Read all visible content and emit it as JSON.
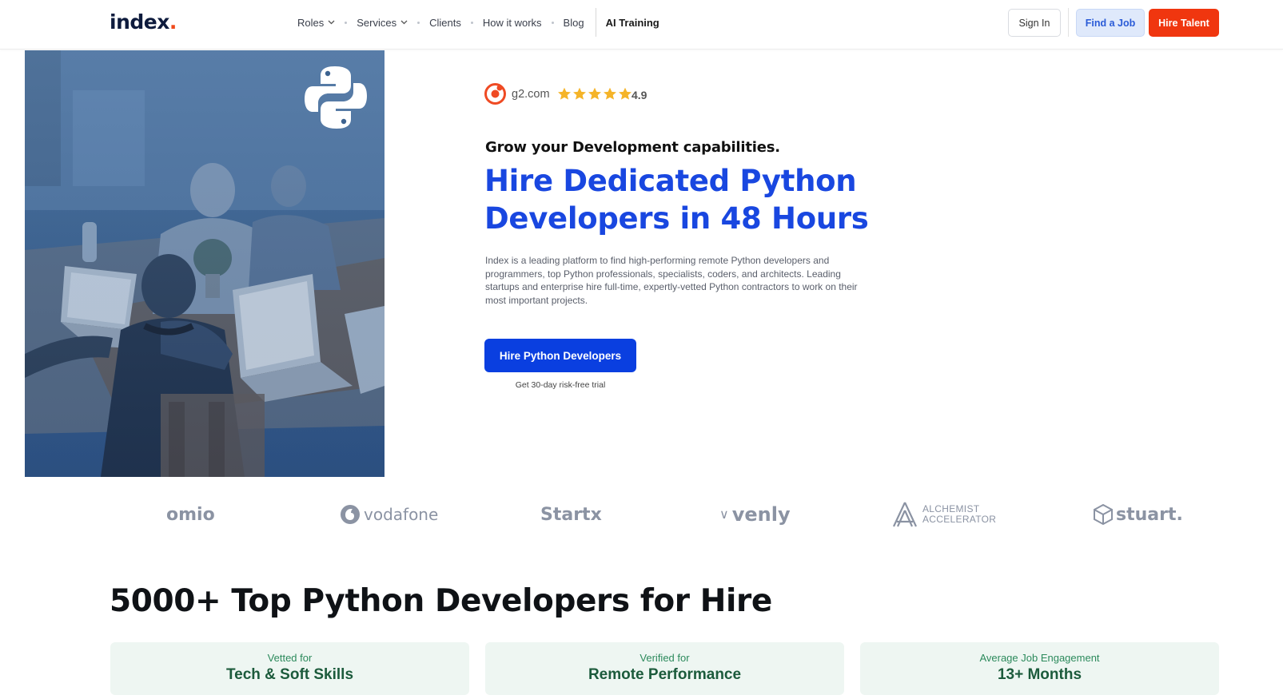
{
  "header": {
    "logo_text": "index",
    "logo_dot": ".",
    "nav": [
      {
        "label": "Roles",
        "dropdown": true
      },
      {
        "label": "Services",
        "dropdown": true
      },
      {
        "label": "Clients",
        "dropdown": false
      },
      {
        "label": "How it works",
        "dropdown": false
      },
      {
        "label": "Blog",
        "dropdown": false
      }
    ],
    "nav_highlight": "AI Training",
    "sign_in": "Sign In",
    "find_job": "Find a Job",
    "hire_talent": "Hire Talent"
  },
  "hero": {
    "rating_source": "g2.com",
    "rating_value": "4.9",
    "eyebrow": "Grow your Development capabilities.",
    "headline": "Hire Dedicated Python Developers in 48 Hours",
    "description": "Index is a leading platform to find high-performing remote Python developers and programmers, top Python professionals, specialists, coders, and architects. Leading startups and enterprise hire full-time, expertly-vetted Python contractors to work on their most important projects.",
    "cta": "Hire Python Developers",
    "cta_note": "Get 30-day risk-free trial"
  },
  "clients": {
    "omio": "omio",
    "vodafone": "vodafone",
    "startx": "Startx",
    "venly": "venly",
    "alchemist_1": "ALCHEMIST",
    "alchemist_2": "ACCELERATOR",
    "stuart": "stuart."
  },
  "section": {
    "title": "5000+ Top Python Developers for Hire"
  },
  "features": [
    {
      "small": "Vetted for",
      "big": "Tech & Soft Skills"
    },
    {
      "small": "Verified for",
      "big": "Remote Performance"
    },
    {
      "small": "Average Job Engagement",
      "big": "13+ Months"
    }
  ],
  "colors": {
    "brand_blue": "#1947e0",
    "cta_blue": "#0a3fe0",
    "hire_red": "#f0360f",
    "feature_bg": "#eef6f2"
  }
}
